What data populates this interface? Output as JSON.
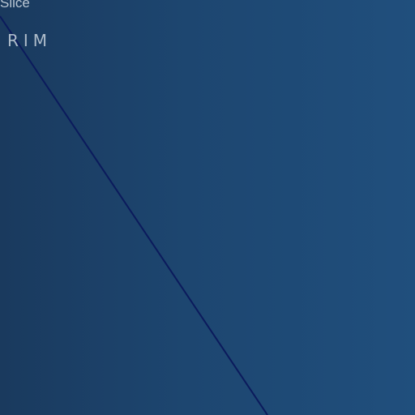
{
  "labels": {
    "slice": "Slice",
    "rim": "RIM"
  },
  "colors": {
    "background_left": "#1a3a5e",
    "background_right": "#204f7d",
    "line": "#0b1a5c",
    "label_text": "#b9c6d3"
  }
}
